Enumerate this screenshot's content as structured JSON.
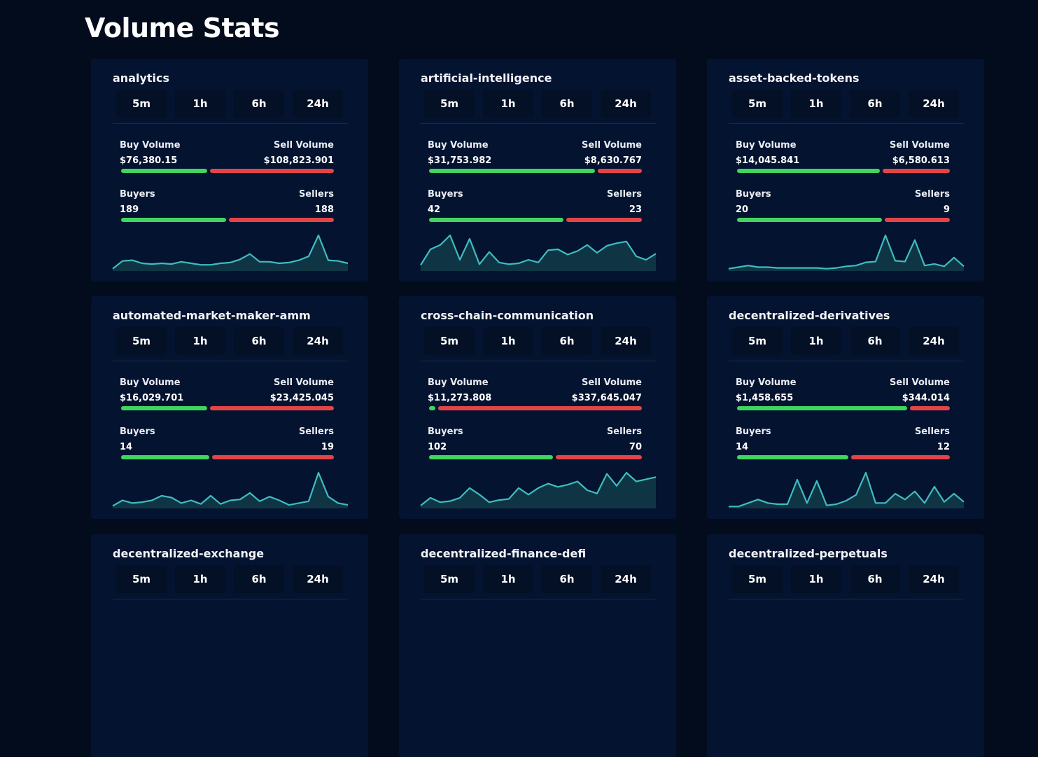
{
  "page": {
    "title": "Volume Stats"
  },
  "colors": {
    "background": "#020c1c",
    "card": "#041330",
    "buy": "#3fd65d",
    "sell": "#e34546",
    "spark_line": "#3fbcbf",
    "spark_fill": "#0f3545"
  },
  "tabs": [
    "5m",
    "1h",
    "6h",
    "24h"
  ],
  "labels": {
    "buy_volume": "Buy Volume",
    "sell_volume": "Sell Volume",
    "buyers": "Buyers",
    "sellers": "Sellers"
  },
  "cards": [
    {
      "title": "analytics",
      "buy_volume": "$76,380.15",
      "sell_volume": "$108,823.901",
      "volume_buy_share": 0.41,
      "buyers": "189",
      "sellers": "188",
      "buyers_share": 0.5,
      "sparkline": [
        2,
        12,
        13,
        9,
        8,
        9,
        8,
        11,
        9,
        7,
        7,
        9,
        10,
        14,
        21,
        11,
        11,
        9,
        10,
        13,
        18,
        45,
        13,
        12,
        9
      ]
    },
    {
      "title": "artificial-intelligence",
      "buy_volume": "$31,753.982",
      "sell_volume": "$8,630.767",
      "volume_buy_share": 0.79,
      "buyers": "42",
      "sellers": "23",
      "buyers_share": 0.64,
      "sparkline": [
        6,
        24,
        29,
        40,
        12,
        36,
        7,
        21,
        9,
        7,
        8,
        12,
        9,
        23,
        24,
        18,
        22,
        29,
        20,
        28,
        31,
        33,
        16,
        12,
        19
      ]
    },
    {
      "title": "asset-backed-tokens",
      "buy_volume": "$14,045.841",
      "sell_volume": "$6,580.613",
      "volume_buy_share": 0.68,
      "buyers": "20",
      "sellers": "9",
      "buyers_share": 0.69,
      "sparkline": [
        2,
        4,
        6,
        4,
        4,
        3,
        3,
        3,
        3,
        3,
        2,
        3,
        5,
        6,
        10,
        11,
        44,
        12,
        11,
        38,
        6,
        8,
        5,
        16,
        5
      ]
    },
    {
      "title": "automated-market-maker-amm",
      "buy_volume": "$16,029.701",
      "sell_volume": "$23,425.045",
      "volume_buy_share": 0.41,
      "buyers": "14",
      "sellers": "19",
      "buyers_share": 0.42,
      "sparkline": [
        2,
        8,
        5,
        6,
        8,
        13,
        11,
        5,
        8,
        4,
        13,
        4,
        8,
        9,
        16,
        7,
        12,
        8,
        3,
        5,
        7,
        38,
        12,
        5,
        3
      ]
    },
    {
      "title": "cross-chain-communication",
      "buy_volume": "$11,273.808",
      "sell_volume": "$337,645.047",
      "volume_buy_share": 0.03,
      "buyers": "102",
      "sellers": "70",
      "buyers_share": 0.59,
      "sparkline": [
        2,
        9,
        5,
        6,
        9,
        18,
        12,
        5,
        7,
        8,
        18,
        12,
        18,
        22,
        19,
        21,
        24,
        16,
        13,
        31,
        20,
        32,
        24,
        26,
        28
      ]
    },
    {
      "title": "decentralized-derivatives",
      "buy_volume": "$1,458.655",
      "sell_volume": "$344.014",
      "volume_buy_share": 0.81,
      "buyers": "14",
      "sellers": "12",
      "buyers_share": 0.53,
      "sparkline": [
        1,
        1,
        4,
        7,
        4,
        3,
        3,
        24,
        4,
        23,
        2,
        3,
        6,
        11,
        30,
        4,
        4,
        12,
        7,
        14,
        4,
        18,
        5,
        12,
        5
      ]
    },
    {
      "title": "decentralized-exchange",
      "buy_volume": "",
      "sell_volume": "",
      "volume_buy_share": 0.5,
      "buyers": "",
      "sellers": "",
      "buyers_share": 0.5,
      "sparkline": []
    },
    {
      "title": "decentralized-finance-defi",
      "buy_volume": "",
      "sell_volume": "",
      "volume_buy_share": 0.5,
      "buyers": "",
      "sellers": "",
      "buyers_share": 0.5,
      "sparkline": []
    },
    {
      "title": "decentralized-perpetuals",
      "buy_volume": "",
      "sell_volume": "",
      "volume_buy_share": 0.5,
      "buyers": "",
      "sellers": "",
      "buyers_share": 0.5,
      "sparkline": []
    }
  ]
}
